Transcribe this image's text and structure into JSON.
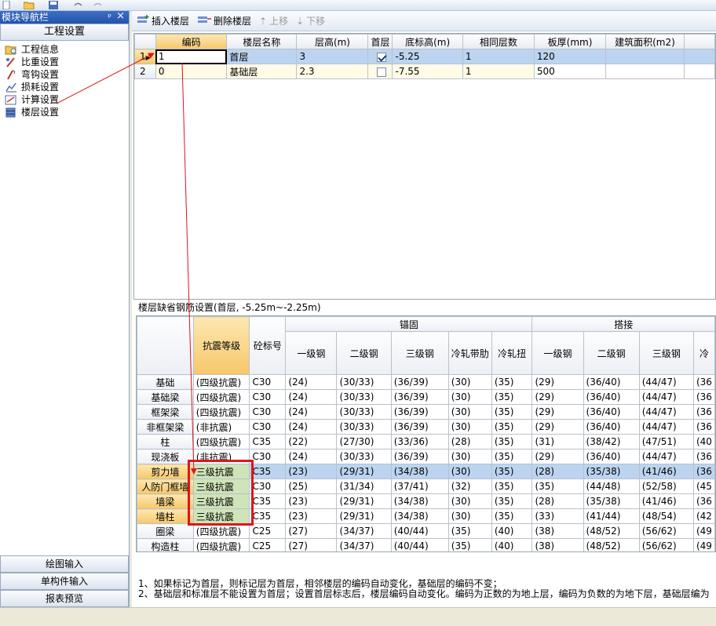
{
  "nav": {
    "title": "模块导航栏",
    "pin_glyph": "ᵖ",
    "close_glyph": "×",
    "section": "工程设置",
    "items": [
      {
        "label": "工程信息",
        "icon": "folder-icon"
      },
      {
        "label": "比重设置",
        "icon": "ruler-icon"
      },
      {
        "label": "弯钩设置",
        "icon": "hook-icon"
      },
      {
        "label": "损耗设置",
        "icon": "chart-icon"
      },
      {
        "label": "计算设置",
        "icon": "calc-icon"
      },
      {
        "label": "楼层设置",
        "icon": "layers-icon"
      }
    ],
    "bottom": [
      "绘图输入",
      "单构件输入",
      "报表预览"
    ]
  },
  "toolbar": {
    "insert": "插入楼层",
    "delete": "删除楼层",
    "up": "上移",
    "down": "下移"
  },
  "floor_table": {
    "headers": [
      "编码",
      "楼层名称",
      "层高(m)",
      "首层",
      "底标高(m)",
      "相同层数",
      "板厚(mm)",
      "建筑面积(m2)"
    ],
    "rows": [
      {
        "n": "1",
        "code": "1",
        "name": "首层",
        "height": "3",
        "first": true,
        "bottom": "-5.25",
        "same": "1",
        "thick": "120",
        "area": ""
      },
      {
        "n": "2",
        "code": "0",
        "name": "基础层",
        "height": "2.3",
        "first": false,
        "bottom": "-7.55",
        "same": "1",
        "thick": "500",
        "area": ""
      }
    ]
  },
  "rebar": {
    "caption": "楼层缺省钢筋设置(首层, -5.25m~-2.25m)",
    "h_seismic": "抗震等级",
    "h_concrete": "砼标号",
    "group_anchor": "锚固",
    "group_lap": "搭接",
    "anchor_cols": [
      "一级钢",
      "二级钢",
      "三级钢",
      "冷轧带肋",
      "冷轧扭"
    ],
    "lap_cols": [
      "一级钢",
      "二级钢",
      "三级钢",
      "冷"
    ],
    "rows": [
      {
        "name": "基础",
        "seismic": "(四级抗震)",
        "concrete": "C30",
        "a": [
          "(24)",
          "(30/33)",
          "(36/39)",
          "(30)",
          "(35)"
        ],
        "l": [
          "(29)",
          "(36/40)",
          "(44/47)",
          "(36"
        ]
      },
      {
        "name": "基础梁",
        "seismic": "(四级抗震)",
        "concrete": "C30",
        "a": [
          "(24)",
          "(30/33)",
          "(36/39)",
          "(30)",
          "(35)"
        ],
        "l": [
          "(29)",
          "(36/40)",
          "(44/47)",
          "(36"
        ]
      },
      {
        "name": "框架梁",
        "seismic": "(四级抗震)",
        "concrete": "C30",
        "a": [
          "(24)",
          "(30/33)",
          "(36/39)",
          "(30)",
          "(35)"
        ],
        "l": [
          "(29)",
          "(36/40)",
          "(44/47)",
          "(36"
        ]
      },
      {
        "name": "非框架梁",
        "seismic": "(非抗震)",
        "concrete": "C30",
        "a": [
          "(24)",
          "(30/33)",
          "(36/39)",
          "(30)",
          "(35)"
        ],
        "l": [
          "(29)",
          "(36/40)",
          "(44/47)",
          "(36"
        ]
      },
      {
        "name": "柱",
        "seismic": "(四级抗震)",
        "concrete": "C35",
        "a": [
          "(22)",
          "(27/30)",
          "(33/36)",
          "(28)",
          "(35)"
        ],
        "l": [
          "(31)",
          "(38/42)",
          "(47/51)",
          "(40"
        ]
      },
      {
        "name": "现浇板",
        "seismic": "(非抗震)",
        "concrete": "C30",
        "a": [
          "(24)",
          "(30/33)",
          "(36/39)",
          "(30)",
          "(35)"
        ],
        "l": [
          "(29)",
          "(36/40)",
          "(44/47)",
          "(36"
        ]
      },
      {
        "name": "剪力墙",
        "seismic": "三级抗震",
        "concrete": "C35",
        "a": [
          "(23)",
          "(29/31)",
          "(34/38)",
          "(30)",
          "(35)"
        ],
        "l": [
          "(28)",
          "(35/38)",
          "(41/46)",
          "(36"
        ]
      },
      {
        "name": "人防门框墙",
        "seismic": "三级抗震",
        "concrete": "C30",
        "a": [
          "(25)",
          "(31/34)",
          "(37/41)",
          "(32)",
          "(35)"
        ],
        "l": [
          "(35)",
          "(44/48)",
          "(52/58)",
          "(45"
        ]
      },
      {
        "name": "墙梁",
        "seismic": "三级抗震",
        "concrete": "C35",
        "a": [
          "(23)",
          "(29/31)",
          "(34/38)",
          "(30)",
          "(35)"
        ],
        "l": [
          "(28)",
          "(35/38)",
          "(41/46)",
          "(36"
        ]
      },
      {
        "name": "墙柱",
        "seismic": "三级抗震",
        "concrete": "C35",
        "a": [
          "(23)",
          "(29/31)",
          "(34/38)",
          "(30)",
          "(35)"
        ],
        "l": [
          "(33)",
          "(41/44)",
          "(48/54)",
          "(42"
        ]
      },
      {
        "name": "圈梁",
        "seismic": "(四级抗震)",
        "concrete": "C25",
        "a": [
          "(27)",
          "(34/37)",
          "(40/44)",
          "(35)",
          "(40)"
        ],
        "l": [
          "(38)",
          "(48/52)",
          "(56/62)",
          "(49"
        ]
      },
      {
        "name": "构造柱",
        "seismic": "(四级抗震)",
        "concrete": "C25",
        "a": [
          "(27)",
          "(34/37)",
          "(40/44)",
          "(35)",
          "(40)"
        ],
        "l": [
          "(38)",
          "(48/52)",
          "(56/62)",
          "(49"
        ]
      }
    ]
  },
  "notes": [
    "1、如果标记为首层，则标记层为首层，相邻楼层的编码自动变化，基础层的编码不变；",
    "2、基础层和标准层不能设置为首层；设置首层标志后，楼层编码自动变化。编码为正数的为地上层，编码为负数的为地下层，基础层编为"
  ],
  "colors": {
    "accent": "#2453a8",
    "highlight": "#e0141a",
    "selection": "#bcd4f0",
    "header_selected": "#f6c86a",
    "green_cell": "#cfe4b8"
  }
}
